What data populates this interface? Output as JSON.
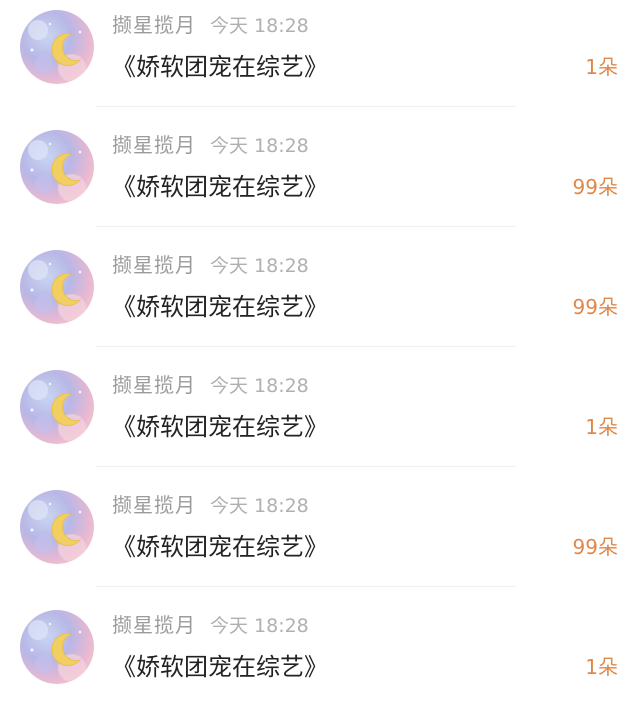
{
  "theme": {
    "count_color": "#e0884a",
    "username_color": "#9b9b9b",
    "timestamp_color": "#b0b0b0",
    "title_color": "#222222"
  },
  "items": [
    {
      "avatar": "crescent-moon-pastel-avatar",
      "username": "撷星揽月",
      "date": "今天",
      "time": "18:28",
      "title": "《娇软团宠在综艺》",
      "count": "1朵"
    },
    {
      "avatar": "crescent-moon-pastel-avatar",
      "username": "撷星揽月",
      "date": "今天",
      "time": "18:28",
      "title": "《娇软团宠在综艺》",
      "count": "99朵"
    },
    {
      "avatar": "crescent-moon-pastel-avatar",
      "username": "撷星揽月",
      "date": "今天",
      "time": "18:28",
      "title": "《娇软团宠在综艺》",
      "count": "99朵"
    },
    {
      "avatar": "crescent-moon-pastel-avatar",
      "username": "撷星揽月",
      "date": "今天",
      "time": "18:28",
      "title": "《娇软团宠在综艺》",
      "count": "1朵"
    },
    {
      "avatar": "crescent-moon-pastel-avatar",
      "username": "撷星揽月",
      "date": "今天",
      "time": "18:28",
      "title": "《娇软团宠在综艺》",
      "count": "99朵"
    },
    {
      "avatar": "crescent-moon-pastel-avatar",
      "username": "撷星揽月",
      "date": "今天",
      "time": "18:28",
      "title": "《娇软团宠在综艺》",
      "count": "1朵"
    }
  ]
}
